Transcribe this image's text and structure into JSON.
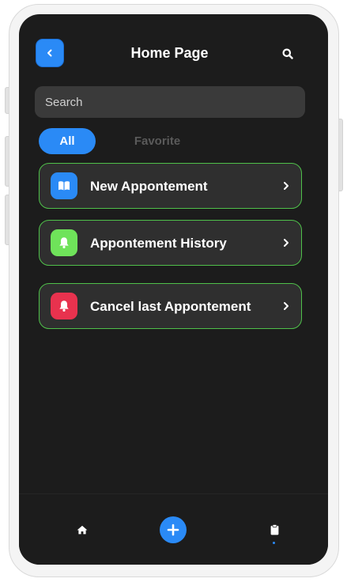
{
  "header": {
    "back_icon": "chevron-left-icon",
    "title": "Home Page",
    "search_icon": "search-icon"
  },
  "search": {
    "placeholder": "Search",
    "value": ""
  },
  "tabs": [
    {
      "label": "All",
      "active": true
    },
    {
      "label": "Favorite",
      "active": false
    }
  ],
  "menu": {
    "items": [
      {
        "label": "New Appontement",
        "icon": "book-icon",
        "icon_color": "#2a8af6"
      },
      {
        "label": "Appontement History",
        "icon": "bell-icon",
        "icon_color": "#6fe35a"
      },
      {
        "label": "Cancel last Appontement",
        "icon": "bell-icon",
        "icon_color": "#e8324e"
      }
    ],
    "chevron_icon": "chevron-right-icon",
    "border_color": "#4fc04a"
  },
  "bottom_nav": {
    "items": [
      {
        "icon": "home-icon"
      },
      {
        "icon": "plus-icon"
      },
      {
        "icon": "clipboard-icon"
      }
    ]
  },
  "colors": {
    "accent": "#2a8af6",
    "background": "#1c1c1c",
    "card": "#2f2f2f"
  }
}
